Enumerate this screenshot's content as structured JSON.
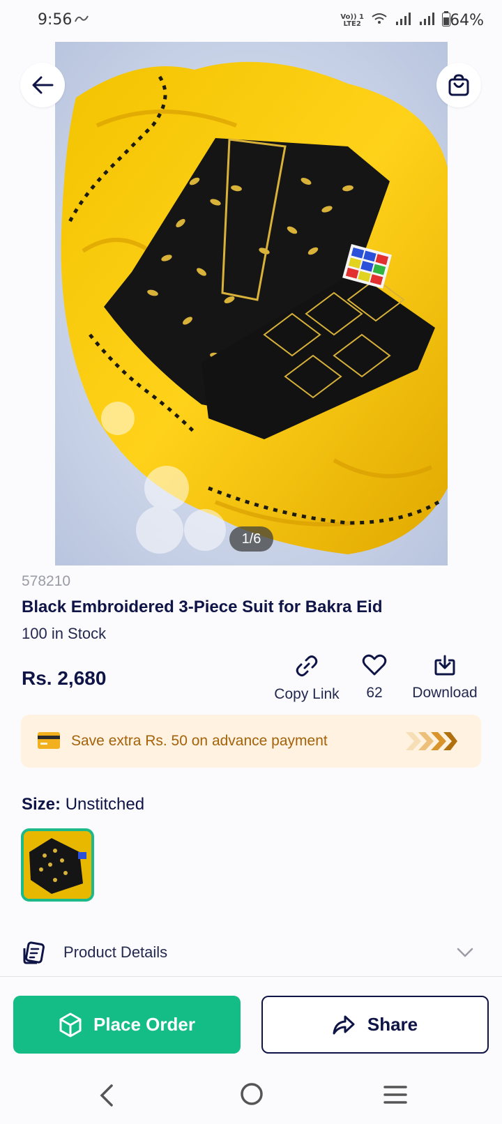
{
  "status_bar": {
    "time": "9:56",
    "network_label": "Vo)) 1\nLTE2",
    "battery": "64%"
  },
  "gallery": {
    "page_indicator": "1/6",
    "current_page": 1,
    "total_pages": 6
  },
  "product": {
    "sku": "578210",
    "title": "Black Embroidered 3-Piece Suit for Bakra Eid",
    "stock": "100 in Stock",
    "price": "Rs. 2,680"
  },
  "actions": {
    "copy_link": "Copy Link",
    "likes": "62",
    "download": "Download"
  },
  "promo": {
    "text": "Save extra Rs. 50 on advance payment"
  },
  "size": {
    "label": "Size:",
    "value": "Unstitched"
  },
  "details": {
    "label": "Product Details"
  },
  "bottom_buttons": {
    "place_order": "Place Order",
    "share": "Share"
  },
  "colors": {
    "accent_green": "#14bc86",
    "navy": "#0f1446",
    "promo_bg": "#fff2e0",
    "promo_text": "#a4620a"
  }
}
